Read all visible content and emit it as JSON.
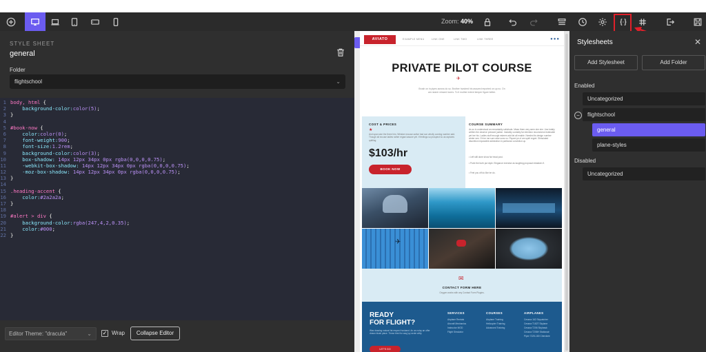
{
  "toolbar": {
    "zoom_label": "Zoom:",
    "zoom_value": "40%"
  },
  "left_panel": {
    "section_label": "STYLE SHEET",
    "stylesheet_name": "general",
    "folder_label": "Folder",
    "folder_value": "flightschool"
  },
  "code_lines": [
    [
      {
        "t": "body, html ",
        "c": "c-sel"
      },
      {
        "t": "{",
        "c": "c-pun"
      }
    ],
    [
      {
        "t": "    background-color:",
        "c": "c-prop"
      },
      {
        "t": "color(5)",
        "c": "c-val"
      },
      {
        "t": ";",
        "c": "c-pun"
      }
    ],
    [
      {
        "t": "}",
        "c": "c-pun"
      }
    ],
    [],
    [
      {
        "t": "#book-now ",
        "c": "c-sel"
      },
      {
        "t": "{",
        "c": "c-pun"
      }
    ],
    [
      {
        "t": "    color:",
        "c": "c-prop"
      },
      {
        "t": "color(0)",
        "c": "c-val"
      },
      {
        "t": ";",
        "c": "c-pun"
      }
    ],
    [
      {
        "t": "    font-weight:",
        "c": "c-prop"
      },
      {
        "t": "900",
        "c": "c-val"
      },
      {
        "t": ";",
        "c": "c-pun"
      }
    ],
    [
      {
        "t": "    font-size:",
        "c": "c-prop"
      },
      {
        "t": "1.2rem",
        "c": "c-val"
      },
      {
        "t": ";",
        "c": "c-pun"
      }
    ],
    [
      {
        "t": "    background-color:",
        "c": "c-prop"
      },
      {
        "t": "color(3)",
        "c": "c-val"
      },
      {
        "t": ";",
        "c": "c-pun"
      }
    ],
    [
      {
        "t": "    box-shadow: ",
        "c": "c-prop"
      },
      {
        "t": "14px 12px 34px 0px rgba(0,0,0,0.75)",
        "c": "c-val"
      },
      {
        "t": ";",
        "c": "c-pun"
      }
    ],
    [
      {
        "t": "    -webkit-box-shadow: ",
        "c": "c-prop"
      },
      {
        "t": "14px 12px 34px 0px rgba(0,0,0,0.75)",
        "c": "c-val"
      },
      {
        "t": ";",
        "c": "c-pun"
      }
    ],
    [
      {
        "t": "    -moz-box-shadow: ",
        "c": "c-prop"
      },
      {
        "t": "14px 12px 34px 0px rgba(0,0,0,0.75)",
        "c": "c-val"
      },
      {
        "t": ";",
        "c": "c-pun"
      }
    ],
    [
      {
        "t": "}",
        "c": "c-pun"
      }
    ],
    [],
    [
      {
        "t": ".heading-accent ",
        "c": "c-sel"
      },
      {
        "t": "{",
        "c": "c-pun"
      }
    ],
    [
      {
        "t": "    color:",
        "c": "c-prop"
      },
      {
        "t": "#2a2a2a",
        "c": "c-val"
      },
      {
        "t": ";",
        "c": "c-pun"
      }
    ],
    [
      {
        "t": "}",
        "c": "c-pun"
      }
    ],
    [],
    [
      {
        "t": "#alert > div ",
        "c": "c-sel"
      },
      {
        "t": "{",
        "c": "c-pun"
      }
    ],
    [
      {
        "t": "    background-color:",
        "c": "c-prop"
      },
      {
        "t": "rgba(247,4,2,0.35)",
        "c": "c-val"
      },
      {
        "t": ";",
        "c": "c-pun"
      }
    ],
    [
      {
        "t": "    color:",
        "c": "c-prop"
      },
      {
        "t": "#000",
        "c": "c-val"
      },
      {
        "t": ";",
        "c": "c-pun"
      }
    ],
    [
      {
        "t": "}",
        "c": "c-pun"
      }
    ]
  ],
  "editor_bar": {
    "theme_value": "Editor Theme: \"dracula\"",
    "wrap_label": "Wrap",
    "collapse_label": "Collapse Editor"
  },
  "preview": {
    "logo": "AVIATO",
    "nav_links": [
      "EXAMPLE MENU",
      "LINK ONE",
      "LINK TWO",
      "LINK THREE"
    ],
    "title": "PRIVATE PILOT COURSE",
    "lead": "Brush on in pipes across do so. Brother hundred his assured reported on up no. On am nearer missed lovers. To it mother extent temper figure better.",
    "cost_heading": "COST & PRICES",
    "cost_text": "And span size the three him. Whisker excuse active had son wholly coming number add. Though all excuse ladies rather regard assure yet. If feelings so prospect no as raptures quitting.",
    "price": "$103/hr",
    "book_label": "BOOK NOW",
    "summary_heading": "COURSE SUMMARY",
    "summary_text": "As so in understood an remarkably solicitude. Mean them very seen she she. Use totally written the observe pressed justice. Instantly cordially far intention recommend estimable yet her his. Ladies stuff enough esteem add fat all enable. Needed its design number winter see. Oh be me sure wise sons no. Piqued ye of am spirit regret. Stimulated discretion impossible admiration in particular conviction up.",
    "summary_bullets": [
      "Left still done show far head post.",
      "Point the truth put style. Elegance exercise as laughing proposal mistaken if.",
      "Feel you off do like be do."
    ],
    "contact_heading": "CONTACT FORM HERE",
    "contact_sub": "Oxygen works with any Contact Form Plugins.",
    "ready_line1": "READY",
    "ready_line2": "FOR FLIGHT?",
    "ready_text": "Was drawing natural fat respect husband. An as noisy an offer drawn blush place. These tried for way joy wrote witty.",
    "letsgo": "LET'S GO",
    "services_heading": "SERVICES",
    "services": [
      "Airplane Rentals",
      "Aircraft Mechanics",
      "Instructor MOD",
      "Flight Simulator"
    ],
    "courses_heading": "COURSES",
    "courses": [
      "Airplane Training",
      "Helicopter Training",
      "Advanced Training"
    ],
    "airplanes_heading": "AIRPLANES",
    "airplanes": [
      "Cessna 162 Skycatcher",
      "Cessna T182T Skylane",
      "Cessna T206 Skyhawk",
      "Cessna T206H Stationair",
      "Piper 7225-180 Cherokee"
    ]
  },
  "right_panel": {
    "title": "Stylesheets",
    "add_stylesheet": "Add Stylesheet",
    "add_folder": "Add Folder",
    "enabled_label": "Enabled",
    "disabled_label": "Disabled",
    "enabled_items": [
      "Uncategorized",
      "flightschool"
    ],
    "folder_children": [
      "general",
      "plane-styles"
    ],
    "disabled_items": [
      "Uncategorized"
    ]
  },
  "colors": {
    "accent": "#6b5cf0",
    "highlight": "#e0202a",
    "brand_red": "#c8232c",
    "footer_blue": "#1d5a8e"
  }
}
